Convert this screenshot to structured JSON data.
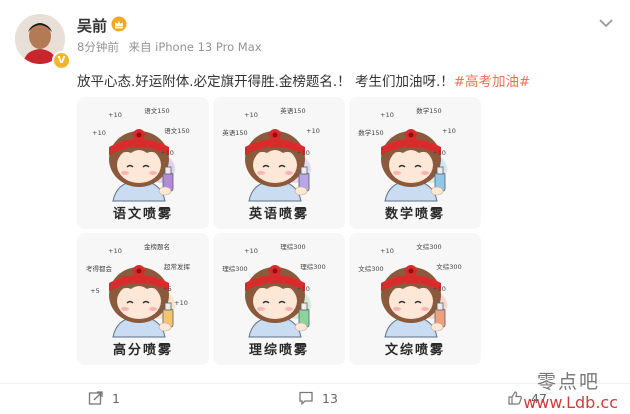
{
  "post": {
    "author": "吴前",
    "time": "8分钟前",
    "source": "来自 iPhone 13 Pro Max",
    "content_text": "放平心态.好运附体.必定旗开得胜.金榜题名.！ 考生们加油呀.！",
    "hashtag": "#高考加油#"
  },
  "images": [
    {
      "label": "语文喷雾",
      "notes": [
        "+10",
        "语文150",
        "+10",
        "语文150",
        "+10"
      ]
    },
    {
      "label": "英语喷雾",
      "notes": [
        "+10",
        "英语150",
        "英语150",
        "+10",
        "+10"
      ]
    },
    {
      "label": "数学喷雾",
      "notes": [
        "+10",
        "数学150",
        "数学150",
        "+10",
        "+10"
      ]
    },
    {
      "label": "高分喷雾",
      "notes": [
        "+10",
        "金榜题名",
        "考得都会",
        "超常发挥",
        "+5",
        "+5",
        "+10"
      ]
    },
    {
      "label": "理综喷雾",
      "notes": [
        "+10",
        "理综300",
        "理综300",
        "理综300",
        "+10"
      ]
    },
    {
      "label": "文综喷雾",
      "notes": [
        "+10",
        "文综300",
        "文综300",
        "文综300",
        "+10"
      ]
    }
  ],
  "actions": {
    "share_count": "1",
    "comment_count": "13",
    "like_count": "47"
  },
  "watermark": {
    "line1": "零点吧",
    "line2": "www.Ldb.cc"
  },
  "colors": {
    "hashtag": "#eb7350",
    "headband": "#d92b2b",
    "hair": "#8b5a3c"
  }
}
